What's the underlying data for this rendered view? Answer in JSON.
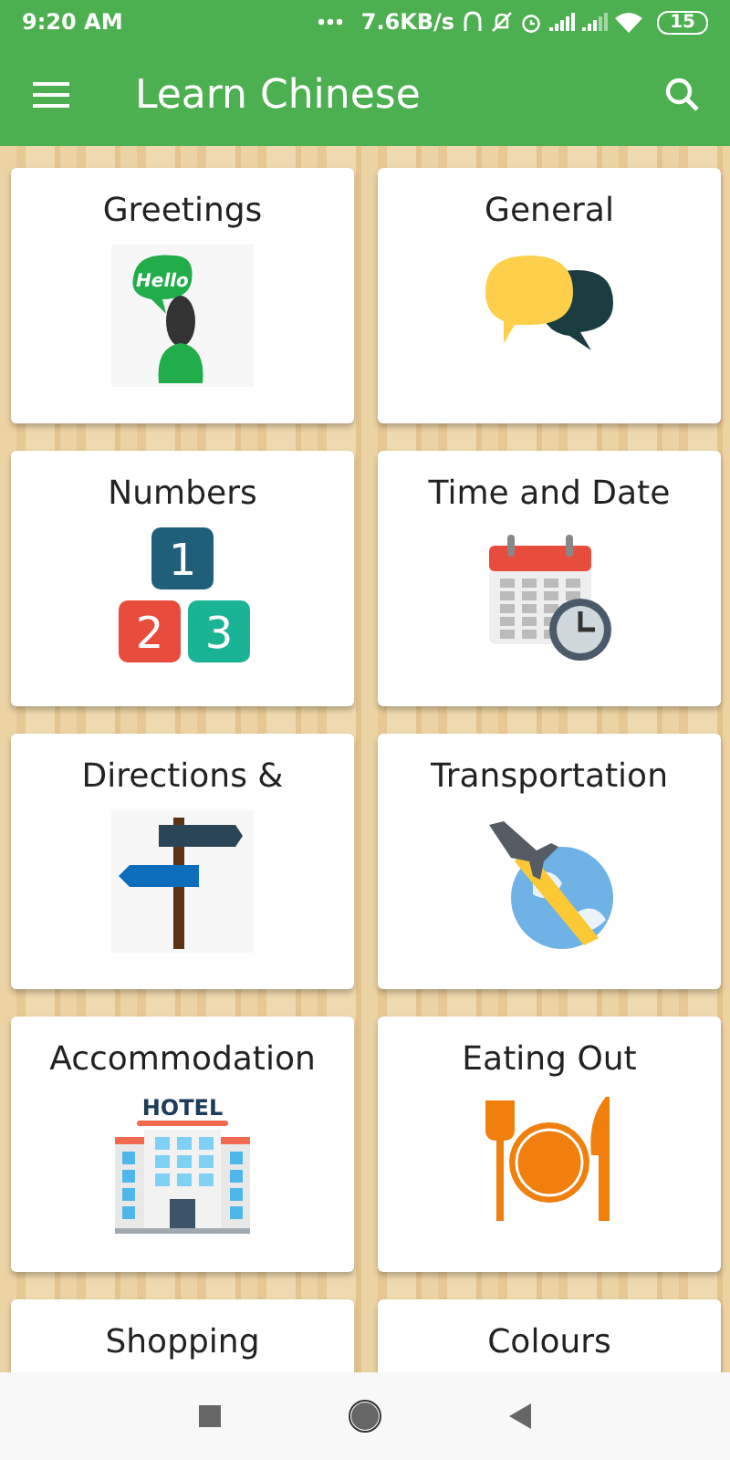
{
  "status_bar": {
    "time": "9:20 AM",
    "speed": "7.6KB/s",
    "battery": "15"
  },
  "app_bar": {
    "title": "Learn Chinese"
  },
  "categories": [
    {
      "title": "Greetings",
      "kind": "greeting",
      "icon_text": [
        "Hello"
      ]
    },
    {
      "title": "General",
      "kind": "chat"
    },
    {
      "title": "Numbers",
      "kind": "numbers",
      "icon_text": [
        "1",
        "2",
        "3"
      ]
    },
    {
      "title": "Time and Date",
      "kind": "calendar"
    },
    {
      "title": "Directions &",
      "kind": "signpost"
    },
    {
      "title": "Transportation",
      "kind": "travel"
    },
    {
      "title": "Accommodation",
      "kind": "hotel",
      "icon_text": [
        "HOTEL"
      ]
    },
    {
      "title": "Eating Out",
      "kind": "dining"
    },
    {
      "title": "Shopping",
      "kind": "none"
    },
    {
      "title": "Colours",
      "kind": "none"
    }
  ]
}
